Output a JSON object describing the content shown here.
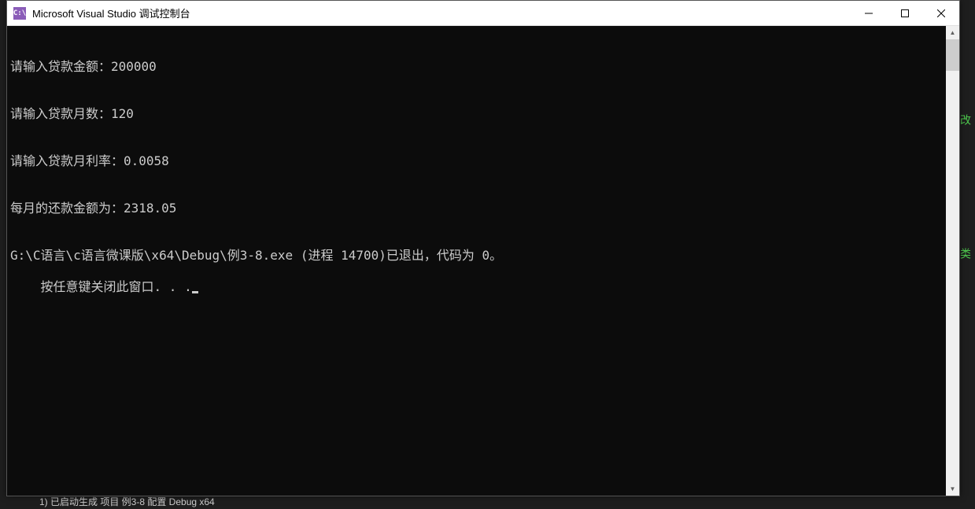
{
  "window": {
    "title": "Microsoft Visual Studio 调试控制台",
    "icon_text": "C:\\"
  },
  "console": {
    "lines": [
      "请输入贷款金额：200000",
      "请输入贷款月数：120",
      "请输入贷款月利率：0.0058",
      "每月的还款金额为：2318.05",
      "G:\\C语言\\c语言微课版\\x64\\Debug\\例3-8.exe (进程 14700)已退出，代码为 0。",
      "按任意键关闭此窗口. . ."
    ]
  },
  "background": {
    "hint1": "改",
    "hint2": "类",
    "bottom_status": "1)          已启动生成   项目   例3-8   配置  Debug  x64"
  }
}
